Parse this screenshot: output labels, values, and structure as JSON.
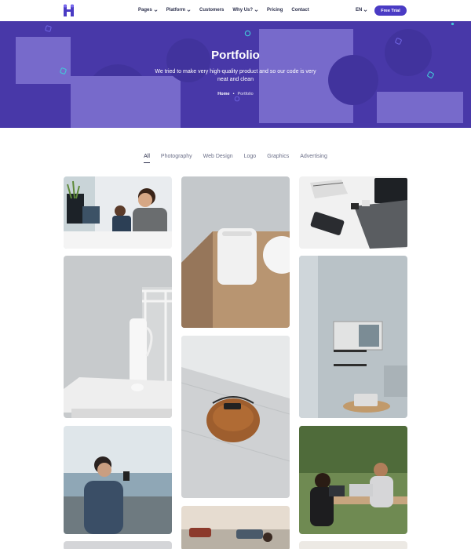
{
  "nav": {
    "menu": [
      {
        "label": "Pages",
        "dropdown": true
      },
      {
        "label": "Platform",
        "dropdown": true
      },
      {
        "label": "Customers",
        "dropdown": false
      },
      {
        "label": "Why Us?",
        "dropdown": true
      },
      {
        "label": "Pricing",
        "dropdown": false
      },
      {
        "label": "Contact",
        "dropdown": false
      }
    ],
    "lang": "EN",
    "cta": "Free Trial"
  },
  "hero": {
    "title": "Portfolio",
    "subtitle": "We tried to make very high-quality product and so our code is very neat and clean",
    "breadcrumb": {
      "home": "Home",
      "separator": "•",
      "current": "Portfolio"
    }
  },
  "filters": {
    "tabs": [
      "All",
      "Photography",
      "Web Design",
      "Logo",
      "Graphics",
      "Advertising"
    ],
    "active": "All"
  },
  "portfolio": {
    "items": [
      {
        "subject": "developers-at-desk-photo"
      },
      {
        "subject": "speaker-on-table-photo"
      },
      {
        "subject": "laptop-and-phone-photo"
      },
      {
        "subject": "vase-on-white-table-photo"
      },
      {
        "subject": "shelf-and-laptop-photo"
      },
      {
        "subject": "leather-bag-photo"
      },
      {
        "subject": "man-with-phone-photo"
      },
      {
        "subject": "street-scene-photo"
      },
      {
        "subject": "people-at-cafe-photo"
      }
    ]
  },
  "colors": {
    "brand": "#4a3bc4",
    "hero_bg": "#5140bd",
    "text_dark": "#2b2f4c",
    "text_muted": "#6b6f88"
  }
}
